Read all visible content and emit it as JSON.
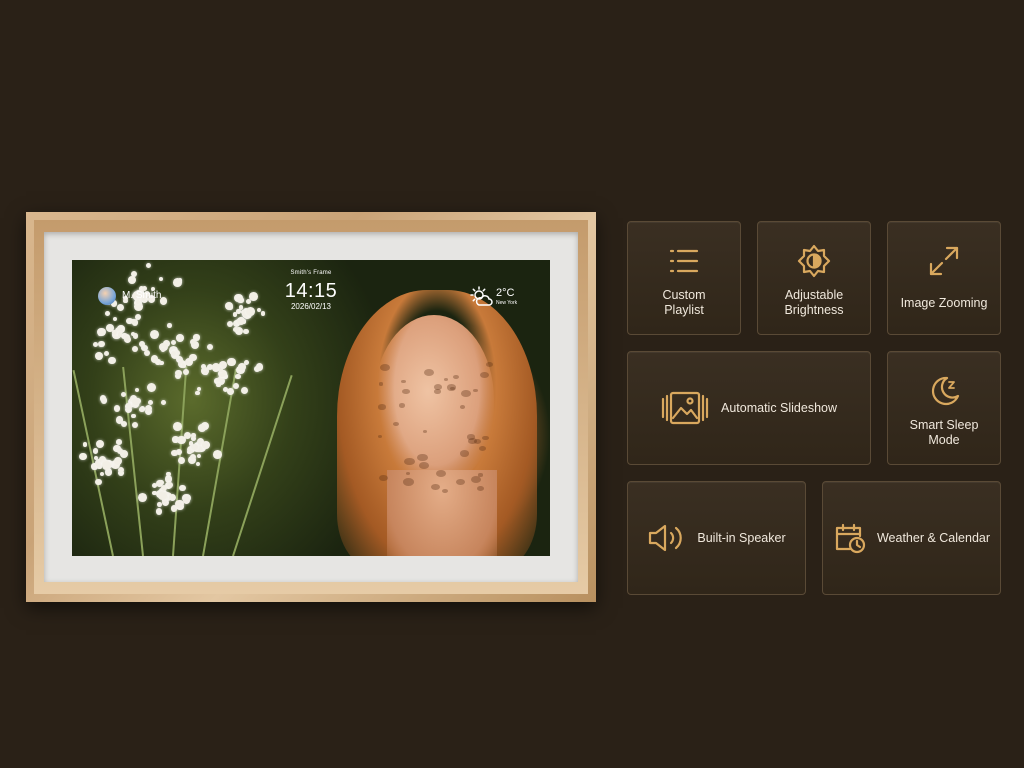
{
  "frame": {
    "screen": {
      "frame_name": "Smith's Frame",
      "owner_name": "M. Smith",
      "time": "14:15",
      "date": "2026/02/13",
      "temperature": "2°C",
      "city": "New York",
      "weather_icon": "partly-cloudy-sun-icon"
    }
  },
  "features": [
    {
      "label": "Custom\nPlaylist",
      "icon": "playlist-icon"
    },
    {
      "label": "Adjustable\nBrightness",
      "icon": "brightness-icon"
    },
    {
      "label": "Image Zooming",
      "icon": "zoom-arrows-icon"
    },
    {
      "label": "Automatic Slideshow",
      "icon": "slideshow-icon"
    },
    {
      "label": "Smart Sleep\nMode",
      "icon": "moon-sleep-icon"
    },
    {
      "label": "Built-in Speaker",
      "icon": "speaker-icon"
    },
    {
      "label": "Weather & Calendar",
      "icon": "calendar-clock-icon"
    }
  ],
  "colors": {
    "background": "#2a2117",
    "accent": "#d9a85e",
    "tile_border": "#5a4a36",
    "frame_wood": "#d9b78e"
  }
}
